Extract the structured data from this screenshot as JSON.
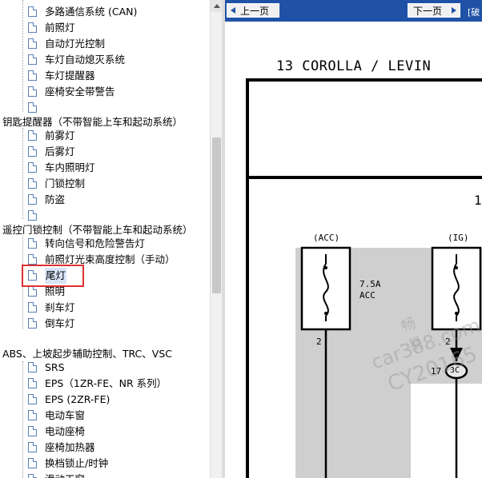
{
  "tree": {
    "items_a": [
      "多路通信系统 (CAN)",
      "前照灯",
      "自动灯光控制",
      "车灯自动熄灭系统",
      "车灯提醒器",
      "座椅安全带警告",
      ""
    ],
    "group_1": "钥匙提醒器（不带智能上车和起动系统）",
    "items_b": [
      "前雾灯",
      "后雾灯",
      "车内照明灯",
      "门锁控制",
      "防盗",
      ""
    ],
    "group_2": "遥控门锁控制（不带智能上车和起动系统）",
    "items_c": [
      "转向信号和危险警告灯",
      "前照灯光束高度控制（手动）",
      "尾灯",
      "照明",
      "刹车灯",
      "倒车灯"
    ],
    "group_3": "ABS、上坡起步辅助控制、TRC、VSC",
    "items_d": [
      "SRS",
      "EPS（1ZR-FE、NR 系列）",
      "EPS (2ZR-FE)",
      "电动车窗",
      "电动座椅",
      "座椅加热器",
      "换档锁止/时钟",
      "滑动天窗"
    ],
    "selected": "尾灯"
  },
  "toolbar": {
    "prev_label": "上一页",
    "next_label": "下一页",
    "extra": "[破"
  },
  "diagram": {
    "title": "13  COROLLA / LEVIN",
    "page_num": "1",
    "fuse1_label": "(ACC)",
    "fuse2_label": "(IG)",
    "fuse1_rating": "7.5A",
    "fuse1_name": "ACC",
    "pin_left": "2",
    "pin_right": "2",
    "connector_pin": "17",
    "connector": "3C"
  },
  "watermark": {
    "line1": "畅易",
    "line2": "car388.com",
    "line3": "CY20165"
  }
}
